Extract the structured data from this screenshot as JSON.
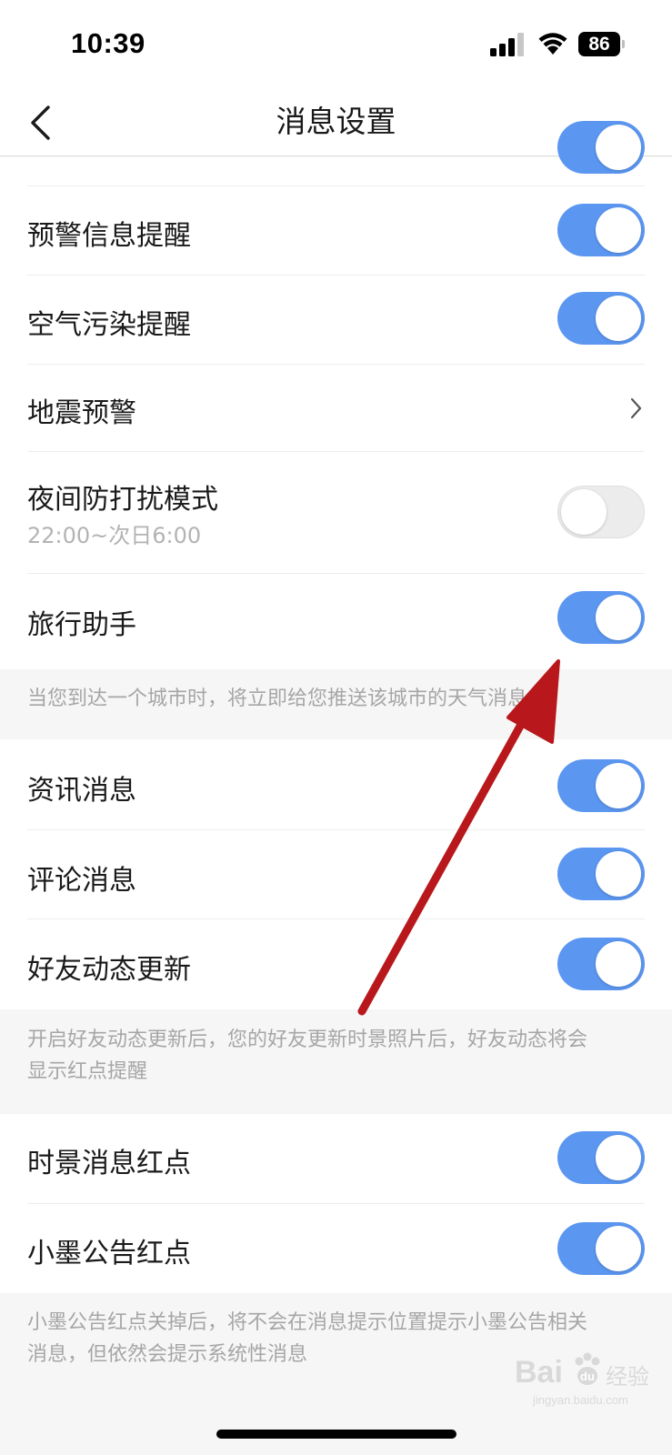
{
  "status_bar": {
    "time": "10:39",
    "battery": "86"
  },
  "nav": {
    "title": "消息设置"
  },
  "rows": [
    {
      "label": "预警信息提醒",
      "on": true
    },
    {
      "label": "空气污染提醒",
      "on": true
    },
    {
      "label": "地震预警"
    },
    {
      "label": "夜间防打扰模式",
      "sub": "22:00~次日6:00",
      "on": false
    },
    {
      "label": "旅行助手",
      "on": true
    },
    {
      "label": "资讯消息",
      "on": true
    },
    {
      "label": "评论消息",
      "on": true
    },
    {
      "label": "好友动态更新",
      "on": true
    },
    {
      "label": "时景消息红点",
      "on": true
    },
    {
      "label": "小墨公告红点",
      "on": true
    }
  ],
  "descriptions": {
    "travel": "当您到达一个城市时，将立即给您推送该城市的天气消息",
    "friends_line1": "开启好友动态更新后，您的好友更新时景照片后，好友动态将会",
    "friends_line2": "显示红点提醒",
    "notice_line1": "小墨公告红点关掉后，将不会在消息提示位置提示小墨公告相关",
    "notice_line2": "消息，但依然会提示系统性消息"
  },
  "watermark": {
    "brand": "Bai",
    "brand_cn": "经验",
    "site": "jingyan.baidu.com"
  },
  "colors": {
    "toggle_on": "#5b96f0",
    "toggle_off": "#ececec",
    "arrow": "#b8181b"
  }
}
